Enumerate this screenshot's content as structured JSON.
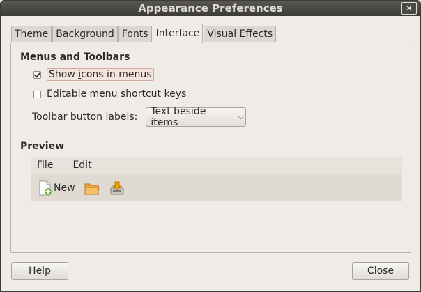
{
  "window": {
    "title": "Appearance Preferences",
    "close_glyph": "✕"
  },
  "tabs": [
    {
      "label": "Theme"
    },
    {
      "label": "Background"
    },
    {
      "label": "Fonts"
    },
    {
      "label": "Interface",
      "active": true
    },
    {
      "label": "Visual Effects"
    }
  ],
  "menus_toolbars": {
    "title": "Menus and Toolbars",
    "show_icons": {
      "label_pre": "Show ",
      "label_mnemonic": "i",
      "label_post": "cons in menus",
      "checked": true
    },
    "editable_shortcuts": {
      "label_pre": "",
      "label_mnemonic": "E",
      "label_post": "ditable menu shortcut keys",
      "checked": false
    },
    "toolbar_labels": {
      "label_pre": "Toolbar ",
      "label_mnemonic": "b",
      "label_post": "utton labels:",
      "value": "Text beside items"
    }
  },
  "preview": {
    "title": "Preview",
    "menu": [
      {
        "mnemonic": "F",
        "rest": "ile"
      },
      {
        "mnemonic": "",
        "rest": "Edit"
      }
    ],
    "toolbar": {
      "new_label": "New",
      "icons": [
        "new-document-icon",
        "open-folder-icon",
        "save-icon"
      ]
    }
  },
  "buttons": {
    "help": {
      "mnemonic": "H",
      "rest": "elp"
    },
    "close": {
      "mnemonic": "C",
      "rest": "lose"
    }
  },
  "colors": {
    "titlebar": "#3c3b37",
    "window_bg": "#efebe7",
    "focus_highlight": "#f3e4de"
  }
}
